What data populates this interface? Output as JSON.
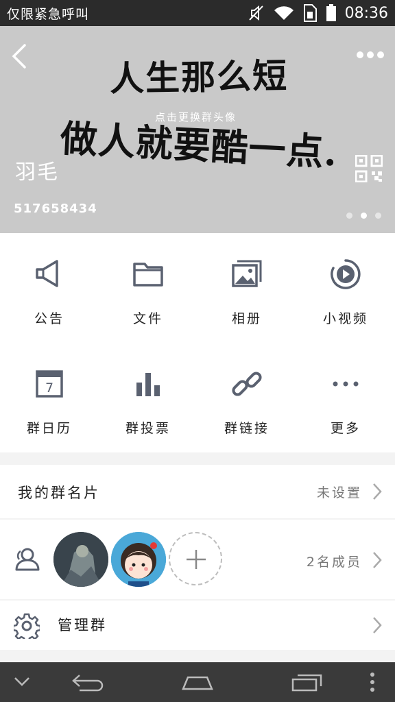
{
  "status_bar": {
    "carrier": "仅限紧急呼叫",
    "time": "08:36",
    "icons": [
      "mute-icon",
      "wifi-icon",
      "sim-icon",
      "battery-icon"
    ]
  },
  "header": {
    "handwriting_line1": "人生那么短",
    "handwriting_line2": "做人就要酷一点.",
    "change_avatar_hint": "点击更换群头像",
    "group_name": "羽毛",
    "group_id": "517658434",
    "page_dots": 3,
    "active_dot": 2,
    "background": "#c9c9c9"
  },
  "features": [
    {
      "label": "公告",
      "icon": "megaphone-icon"
    },
    {
      "label": "文件",
      "icon": "folder-icon"
    },
    {
      "label": "相册",
      "icon": "album-icon"
    },
    {
      "label": "小视频",
      "icon": "video-icon"
    },
    {
      "label": "群日历",
      "icon": "calendar-icon"
    },
    {
      "label": "群投票",
      "icon": "bar-chart-icon"
    },
    {
      "label": "群链接",
      "icon": "link-icon"
    },
    {
      "label": "更多",
      "icon": "more-icon"
    }
  ],
  "card_row": {
    "title": "我的群名片",
    "value": "未设置"
  },
  "members_row": {
    "count_label": "2名成员"
  },
  "manage_row": {
    "title": "管理群"
  },
  "colors": {
    "icon": "#5a6170",
    "status_bar": "#2b2b2b",
    "nav_bar": "#3a3a3a"
  }
}
